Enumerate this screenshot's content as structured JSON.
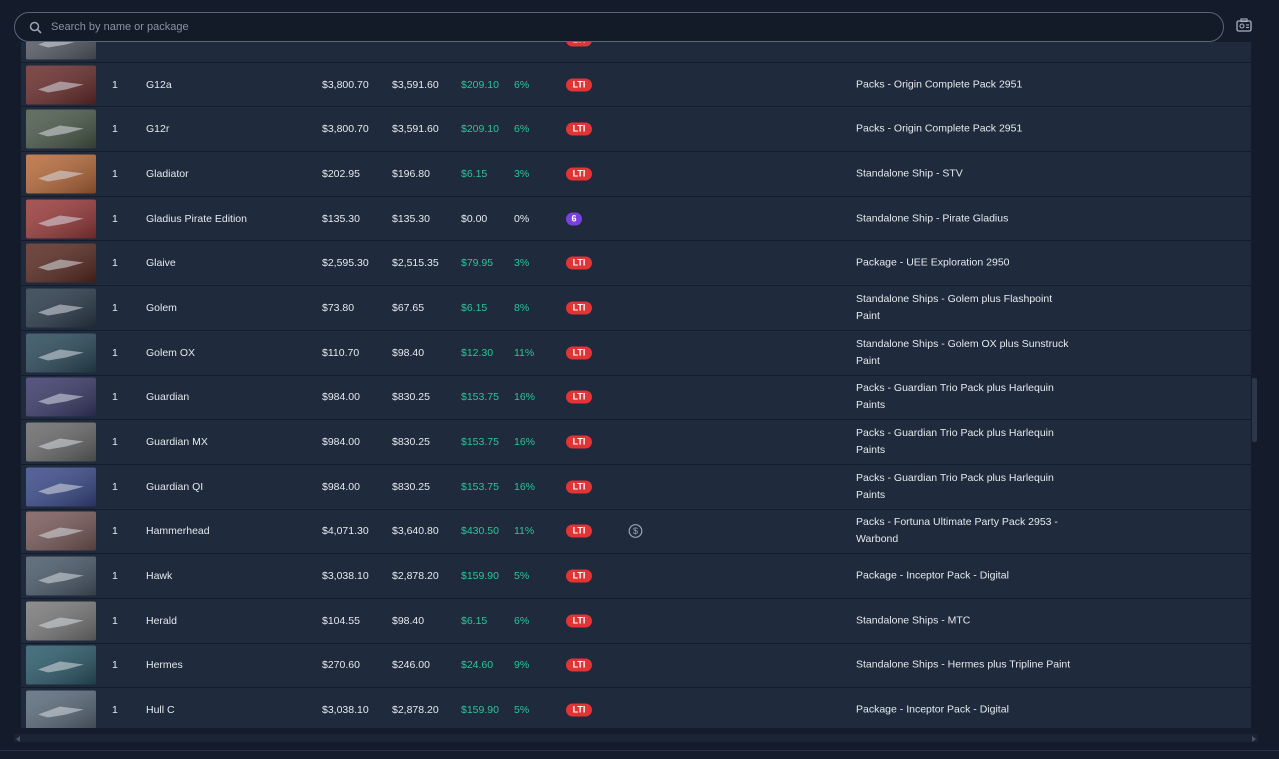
{
  "search": {
    "placeholder": "Search by name or package"
  },
  "colors": {
    "lti": "#e23434",
    "positive": "#2bc59b",
    "badge_number": "#7b3fe0"
  },
  "rows": [
    {
      "qty": "",
      "name": "",
      "price": "",
      "value": "",
      "diff": "",
      "pct": "",
      "insurance": "LTI",
      "source": "",
      "thumb": "#5a5f6a"
    },
    {
      "qty": "1",
      "name": "G12a",
      "price": "$3,800.70",
      "value": "$3,591.60",
      "diff": "$209.10",
      "pct": "6%",
      "insurance": "LTI",
      "source": "Packs - Origin Complete Pack 2951",
      "thumb": "#6a2c2c"
    },
    {
      "qty": "1",
      "name": "G12r",
      "price": "$3,800.70",
      "value": "$3,591.60",
      "diff": "$209.10",
      "pct": "6%",
      "insurance": "LTI",
      "source": "Packs - Origin Complete Pack 2951",
      "thumb": "#4a5a4a"
    },
    {
      "qty": "1",
      "name": "Gladiator",
      "price": "$202.95",
      "value": "$196.80",
      "diff": "$6.15",
      "pct": "3%",
      "insurance": "LTI",
      "source": "Standalone Ship - STV",
      "thumb": "#b86a3a"
    },
    {
      "qty": "1",
      "name": "Gladius Pirate Edition",
      "price": "$135.30",
      "value": "$135.30",
      "diff": "$0.00",
      "pct": "0%",
      "insurance": "6",
      "source": "Standalone Ship - Pirate Gladius",
      "thumb": "#9a3a3a"
    },
    {
      "qty": "1",
      "name": "Glaive",
      "price": "$2,595.30",
      "value": "$2,515.35",
      "diff": "$79.95",
      "pct": "3%",
      "insurance": "LTI",
      "source": "Package - UEE Exploration 2950",
      "thumb": "#5a2a22"
    },
    {
      "qty": "1",
      "name": "Golem",
      "price": "$73.80",
      "value": "$67.65",
      "diff": "$6.15",
      "pct": "8%",
      "insurance": "LTI",
      "source": "Standalone Ships - Golem plus Flashpoint Paint",
      "thumb": "#2a3a4a"
    },
    {
      "qty": "1",
      "name": "Golem OX",
      "price": "$110.70",
      "value": "$98.40",
      "diff": "$12.30",
      "pct": "11%",
      "insurance": "LTI",
      "source": "Standalone Ships - Golem OX plus Sunstruck Paint",
      "thumb": "#2a4a5a"
    },
    {
      "qty": "1",
      "name": "Guardian",
      "price": "$984.00",
      "value": "$830.25",
      "diff": "$153.75",
      "pct": "16%",
      "insurance": "LTI",
      "source": "Packs - Guardian Trio Pack plus Harlequin Paints",
      "thumb": "#3a3a6a"
    },
    {
      "qty": "1",
      "name": "Guardian MX",
      "price": "$984.00",
      "value": "$830.25",
      "diff": "$153.75",
      "pct": "16%",
      "insurance": "LTI",
      "source": "Packs - Guardian Trio Pack plus Harlequin Paints",
      "thumb": "#6a6a6a"
    },
    {
      "qty": "1",
      "name": "Guardian QI",
      "price": "$984.00",
      "value": "$830.25",
      "diff": "$153.75",
      "pct": "16%",
      "insurance": "LTI",
      "source": "Packs - Guardian Trio Pack plus Harlequin Paints",
      "thumb": "#3a4a8a"
    },
    {
      "qty": "1",
      "name": "Hammerhead",
      "price": "$4,071.30",
      "value": "$3,640.80",
      "diff": "$430.50",
      "pct": "11%",
      "insurance": "LTI",
      "pledge_icon": "dollar-coin-icon",
      "source": "Packs - Fortuna Ultimate Party Pack 2953 - Warbond",
      "thumb": "#7a5a5a"
    },
    {
      "qty": "1",
      "name": "Hawk",
      "price": "$3,038.10",
      "value": "$2,878.20",
      "diff": "$159.90",
      "pct": "5%",
      "insurance": "LTI",
      "source": "Package - Inceptor Pack - Digital",
      "thumb": "#4a5a6a"
    },
    {
      "qty": "1",
      "name": "Herald",
      "price": "$104.55",
      "value": "$98.40",
      "diff": "$6.15",
      "pct": "6%",
      "insurance": "LTI",
      "source": "Standalone Ships - MTC",
      "thumb": "#7a7a7a"
    },
    {
      "qty": "1",
      "name": "Hermes",
      "price": "$270.60",
      "value": "$246.00",
      "diff": "$24.60",
      "pct": "9%",
      "insurance": "LTI",
      "source": "Standalone Ships - Hermes plus Tripline Paint",
      "thumb": "#2a5a6a"
    },
    {
      "qty": "1",
      "name": "Hull C",
      "price": "$3,038.10",
      "value": "$2,878.20",
      "diff": "$159.90",
      "pct": "5%",
      "insurance": "LTI",
      "source": "Package - Inceptor Pack - Digital",
      "thumb": "#5a6a7a"
    }
  ]
}
